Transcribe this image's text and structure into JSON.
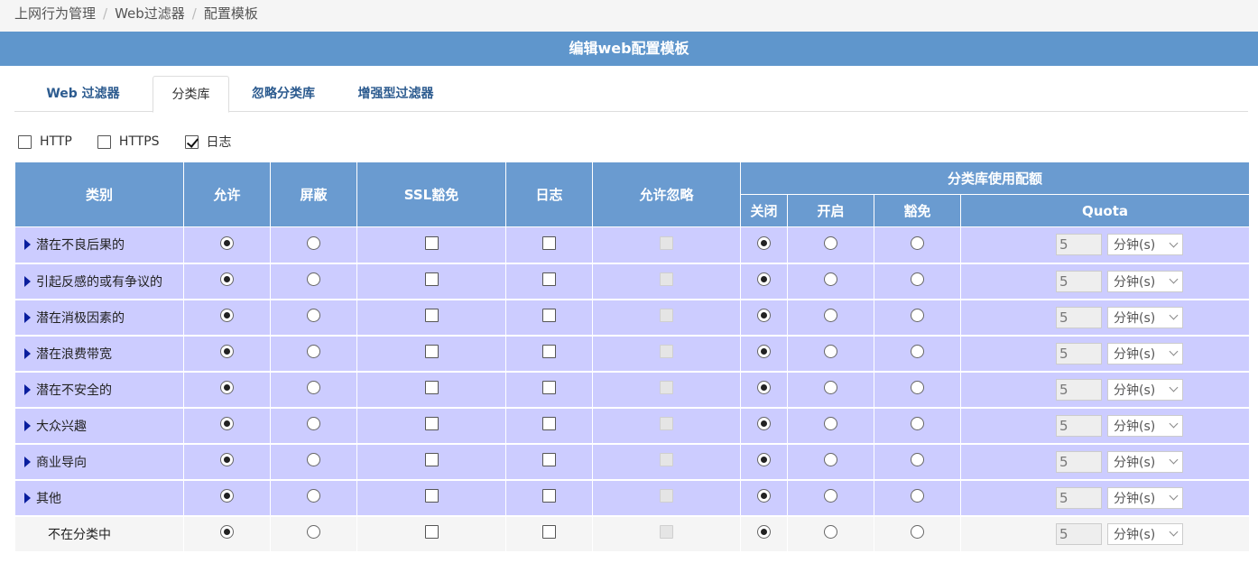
{
  "breadcrumb": [
    "上网行为管理",
    "Web过滤器",
    "配置模板"
  ],
  "title": "编辑web配置模板",
  "tabs": [
    "Web 过滤器",
    "分类库",
    "忽略分类库",
    "增强型过滤器"
  ],
  "active_tab": 1,
  "protocols": [
    {
      "label": "HTTP",
      "checked": false
    },
    {
      "label": "HTTPS",
      "checked": false
    },
    {
      "label": "日志",
      "checked": true
    }
  ],
  "headers": {
    "category": "类别",
    "allow": "允许",
    "block": "屏蔽",
    "ssl_exempt": "SSL豁免",
    "log": "日志",
    "allow_ignore": "允许忽略",
    "quota_group": "分类库使用配额",
    "off": "关闭",
    "on": "开启",
    "exempt": "豁免",
    "quota": "Quota"
  },
  "rows": [
    {
      "name": "潜在不良后果的",
      "expandable": true,
      "quota": "5",
      "unit": "分钟(s)"
    },
    {
      "name": "引起反感的或有争议的",
      "expandable": true,
      "quota": "5",
      "unit": "分钟(s)"
    },
    {
      "name": "潜在消极因素的",
      "expandable": true,
      "quota": "5",
      "unit": "分钟(s)"
    },
    {
      "name": "潜在浪费带宽",
      "expandable": true,
      "quota": "5",
      "unit": "分钟(s)"
    },
    {
      "name": "潜在不安全的",
      "expandable": true,
      "quota": "5",
      "unit": "分钟(s)"
    },
    {
      "name": "大众兴趣",
      "expandable": true,
      "quota": "5",
      "unit": "分钟(s)"
    },
    {
      "name": "商业导向",
      "expandable": true,
      "quota": "5",
      "unit": "分钟(s)"
    },
    {
      "name": "其他",
      "expandable": true,
      "quota": "5",
      "unit": "分钟(s)"
    },
    {
      "name": "不在分类中",
      "expandable": false,
      "quota": "5",
      "unit": "分钟(s)"
    }
  ],
  "colors": {
    "header_blue": "#5f96cc",
    "row_lavender": "#ccccff",
    "tab_link": "#2c5b8f",
    "expand_triangle": "#0a1e9e"
  }
}
